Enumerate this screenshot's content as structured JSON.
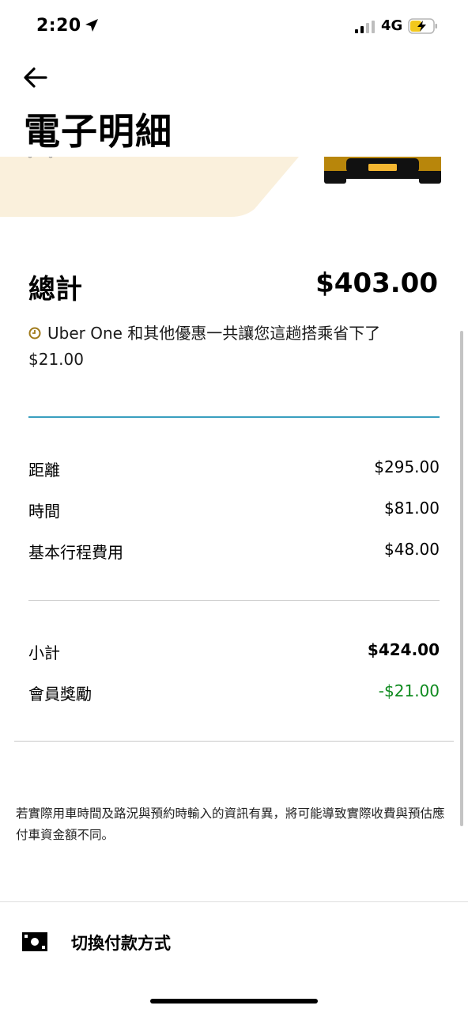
{
  "status_bar": {
    "time": "2:20",
    "network": "4G"
  },
  "header": {
    "title": "電子明細"
  },
  "total": {
    "label": "總計",
    "value": "$403.00"
  },
  "promo": {
    "text": "Uber One 和其他優惠一共讓您這趟搭乘省下了 $21.00"
  },
  "breakdown": [
    {
      "label": "距離",
      "value": "$295.00"
    },
    {
      "label": "時間",
      "value": "$81.00"
    },
    {
      "label": "基本行程費用",
      "value": "$48.00"
    }
  ],
  "subtotal": {
    "label": "小計",
    "value": "$424.00"
  },
  "reward": {
    "label": "會員獎勵",
    "value": "-$21.00"
  },
  "disclaimer": "若實際用車時間及路況與預約時輸入的資訊有異，將可能導致實際收費與預估應付車資金額不同。",
  "payment": {
    "label": "切換付款方式"
  },
  "colors": {
    "accent_line": "#3a9fbf",
    "reward": "#0e8a1e",
    "banner": "#faf0dc",
    "car": "#b8860b"
  }
}
